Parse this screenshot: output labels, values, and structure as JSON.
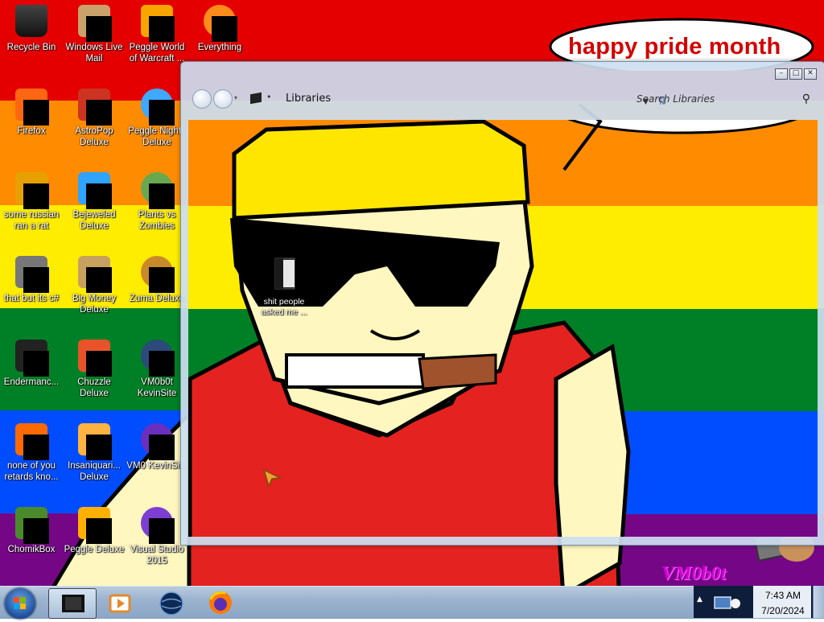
{
  "wallpaper": {
    "speech_text": "happy pride month",
    "signature": "VM0b0t"
  },
  "desktop_icons": [
    {
      "label": "Recycle Bin",
      "icon": "recycle-bin-icon"
    },
    {
      "label": "Windows Live Mail",
      "icon": "mail-icon"
    },
    {
      "label": "Peggle World of Warcraft ...",
      "icon": "peggle-wow-icon"
    },
    {
      "label": "Everything",
      "icon": "everything-search-icon"
    },
    {
      "label": "Firefox",
      "icon": "firefox-icon"
    },
    {
      "label": "AstroPop Deluxe",
      "icon": "astropop-icon"
    },
    {
      "label": "Peggle Nights Deluxe",
      "icon": "peggle-nights-icon"
    },
    {
      "label": "some russian ran a rat",
      "icon": "game-icon"
    },
    {
      "label": "Bejeweled Deluxe",
      "icon": "bejeweled-icon"
    },
    {
      "label": "Plants vs Zombies",
      "icon": "plants-vs-zombies-icon"
    },
    {
      "label": "that but its c#",
      "icon": "shortcut-icon"
    },
    {
      "label": "Big Money Deluxe",
      "icon": "money-bag-icon"
    },
    {
      "label": "Zuma Deluxe",
      "icon": "zuma-icon"
    },
    {
      "label": "Endermanc...",
      "icon": "terminal-icon"
    },
    {
      "label": "Chuzzle Deluxe",
      "icon": "chuzzle-icon"
    },
    {
      "label": "VM0b0t KevinSite",
      "icon": "website-icon"
    },
    {
      "label": "none of you retards kno...",
      "icon": "game-icon"
    },
    {
      "label": "Insaniquari... Deluxe",
      "icon": "fish-icon"
    },
    {
      "label": "VM0 KevinSi...",
      "icon": "website-icon"
    },
    {
      "label": "ChomikBox",
      "icon": "chomikbox-icon"
    },
    {
      "label": "Peggle Deluxe",
      "icon": "peggle-icon"
    },
    {
      "label": "Visual Studio 2015",
      "icon": "visual-studio-icon"
    }
  ],
  "window": {
    "address": "Libraries",
    "search_placeholder": "Search Libraries",
    "caption_minimize": "–",
    "caption_maximize": "□",
    "caption_close": "✕",
    "folder_item": {
      "label": "shit people asked me ...",
      "icon": "folder-icon"
    }
  },
  "taskbar": {
    "pinned": [
      "explorer-icon",
      "media-player-icon",
      "globe-icon",
      "firefox-icon"
    ],
    "time": "7:43 AM",
    "date": "7/20/2024"
  },
  "colors": {
    "flag": [
      "#e50000",
      "#ff8c00",
      "#ffed00",
      "#008026",
      "#004dff",
      "#750787"
    ],
    "speech_text": "#d40000",
    "taskbar": "#9cb3cf"
  }
}
